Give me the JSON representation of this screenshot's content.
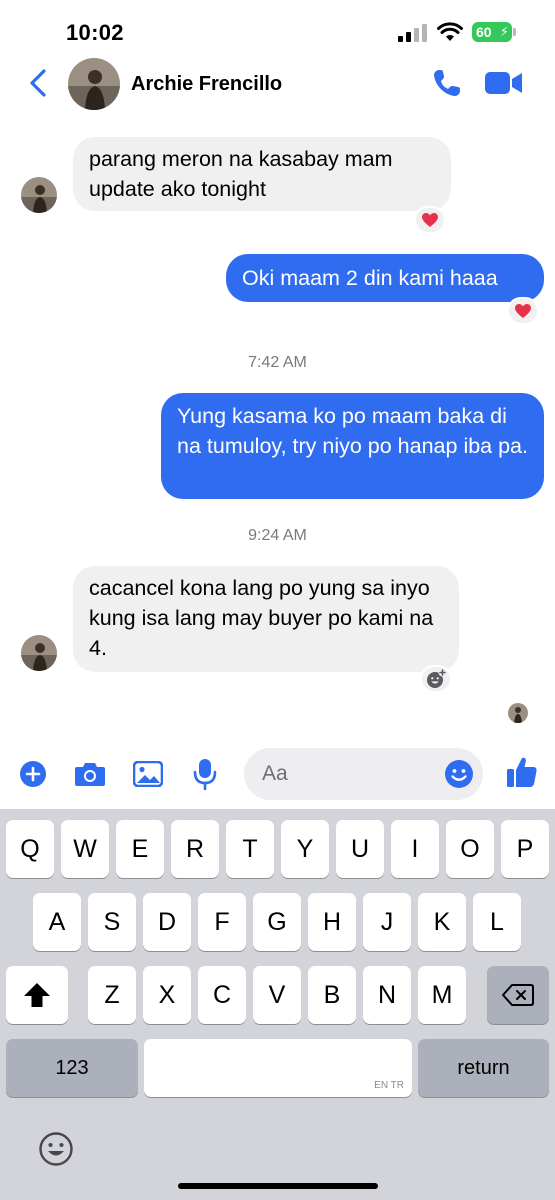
{
  "status_bar": {
    "time": "10:02",
    "battery": "60"
  },
  "header": {
    "contact_name": "Archie Frencillo"
  },
  "conversation": [
    {
      "type": "message",
      "direction": "incoming",
      "text": "parang meron na kasabay mam update ako tonight",
      "reaction": "heart"
    },
    {
      "type": "message",
      "direction": "outgoing",
      "text": "Oki maam 2 din kami haaa",
      "reaction": "heart"
    },
    {
      "type": "timestamp",
      "text": "7:42 AM"
    },
    {
      "type": "message",
      "direction": "outgoing",
      "text": "Yung kasama ko po maam baka di na tumuloy, try niyo po hanap iba pa."
    },
    {
      "type": "timestamp",
      "text": "9:24 AM"
    },
    {
      "type": "message",
      "direction": "incoming",
      "text": "cacancel kona lang po yung sa inyo kung isa lang may buyer po kami na 4.",
      "reaction": "add-reaction"
    }
  ],
  "composer": {
    "placeholder": "Aa"
  },
  "keyboard": {
    "row1": [
      "Q",
      "W",
      "E",
      "R",
      "T",
      "Y",
      "U",
      "I",
      "O",
      "P"
    ],
    "row2": [
      "A",
      "S",
      "D",
      "F",
      "G",
      "H",
      "J",
      "K",
      "L"
    ],
    "row3": [
      "Z",
      "X",
      "C",
      "V",
      "B",
      "N",
      "M"
    ],
    "numbers_label": "123",
    "return_label": "return",
    "space_hint": "EN TR"
  },
  "colors": {
    "accent": "#2f6cf0",
    "incoming_bubble": "#f0f0f1",
    "keyboard_bg": "#d2d4d9",
    "battery": "#34c759"
  }
}
